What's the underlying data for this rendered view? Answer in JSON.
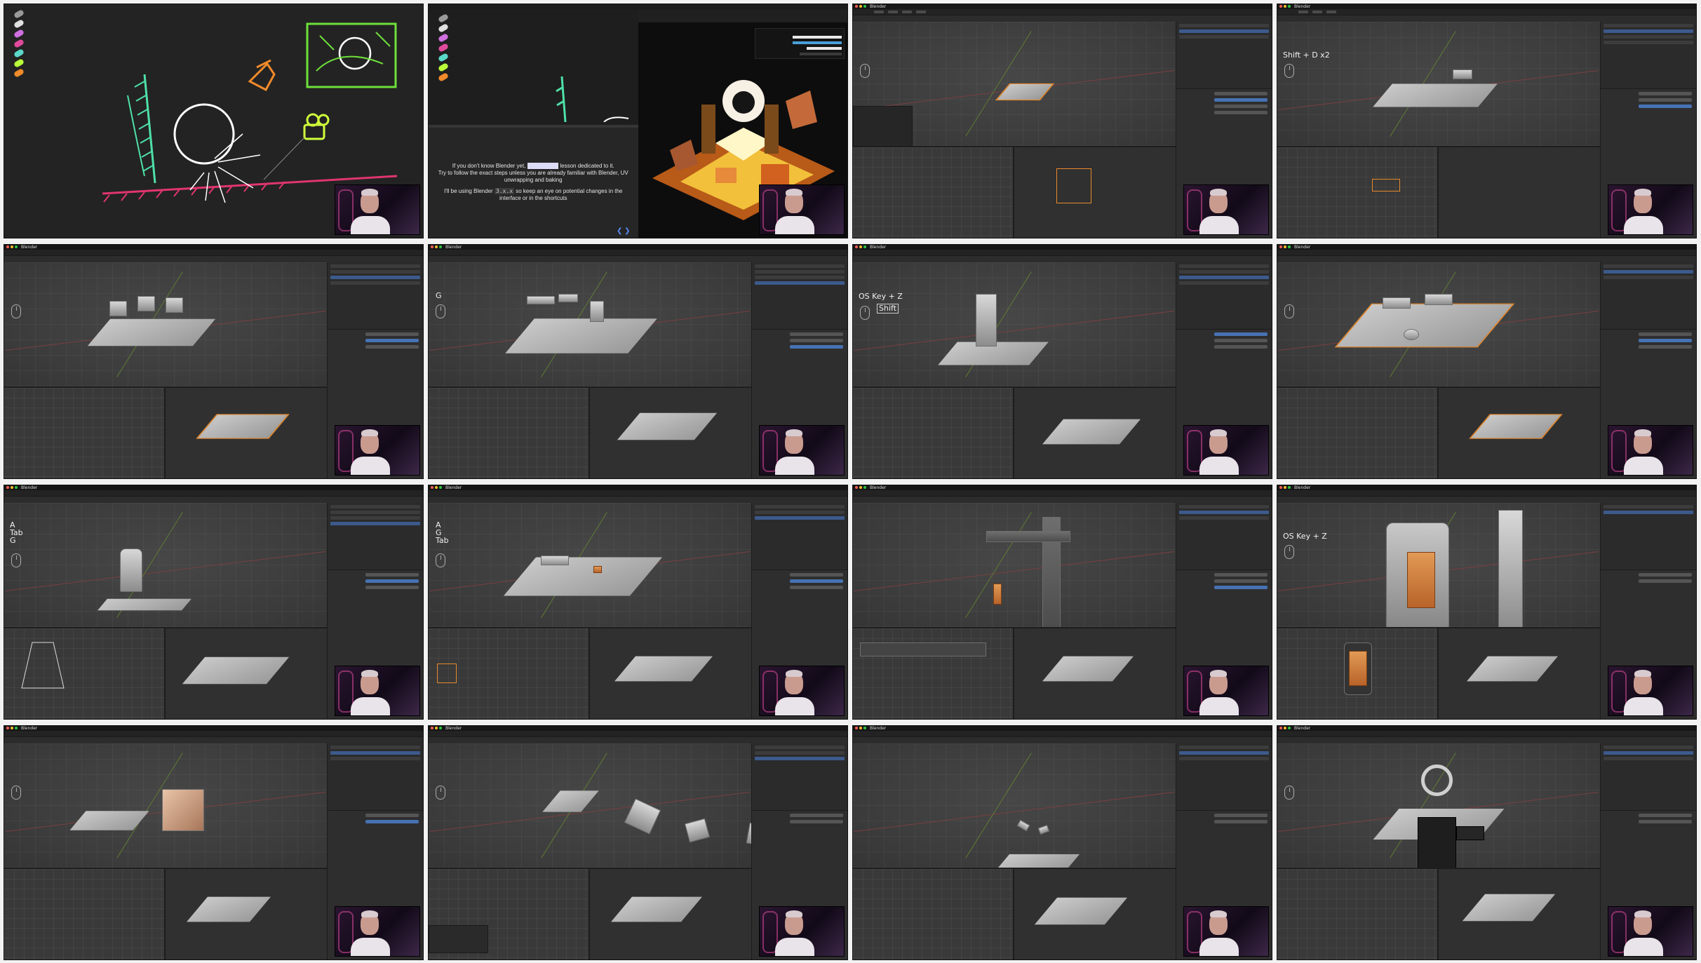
{
  "frames": [
    {
      "kind": "drawing-board"
    },
    {
      "kind": "browser-dialog",
      "dialog": {
        "line1_prefix": "If you don't know Blender yet,",
        "line1_suffix": "lesson dedicated to it.",
        "line2": "Try to follow the exact steps unless you are already familiar with Blender, UV unwrapping and baking",
        "line3_prefix": "I'll be using Blender",
        "version": "3.x.x",
        "line3_suffix": "so keep an eye on potential changes in the interface or in the shortcuts"
      }
    },
    {
      "kind": "blender",
      "shortcut": ""
    },
    {
      "kind": "blender",
      "shortcut": "Shift + D x2"
    },
    {
      "kind": "blender",
      "shortcut": ""
    },
    {
      "kind": "blender",
      "shortcut": "G"
    },
    {
      "kind": "blender",
      "shortcut": "OS Key + Z",
      "boxed_key": "Shift"
    },
    {
      "kind": "blender",
      "shortcut": ""
    },
    {
      "kind": "blender",
      "shortcut_lines": [
        "A",
        "Tab",
        "G"
      ]
    },
    {
      "kind": "blender",
      "shortcut_lines": [
        "A",
        "G",
        "Tab"
      ]
    },
    {
      "kind": "blender",
      "shortcut": ""
    },
    {
      "kind": "blender",
      "shortcut": "OS Key + Z"
    },
    {
      "kind": "blender",
      "shortcut": ""
    },
    {
      "kind": "blender",
      "shortcut": ""
    },
    {
      "kind": "blender",
      "shortcut": ""
    },
    {
      "kind": "blender",
      "shortcut": ""
    }
  ],
  "app": {
    "name": "Blender"
  },
  "colors": {
    "selection_orange": "#e88a2c",
    "blender_blue": "#4772b3",
    "swatches": [
      "#9a9a9a",
      "#e0e0e0",
      "#d070e0",
      "#e04a9c",
      "#5ad8c8",
      "#b8ff3a",
      "#f08a2a"
    ]
  },
  "icons": [
    "mouse-icon",
    "traffic-light-icons"
  ]
}
